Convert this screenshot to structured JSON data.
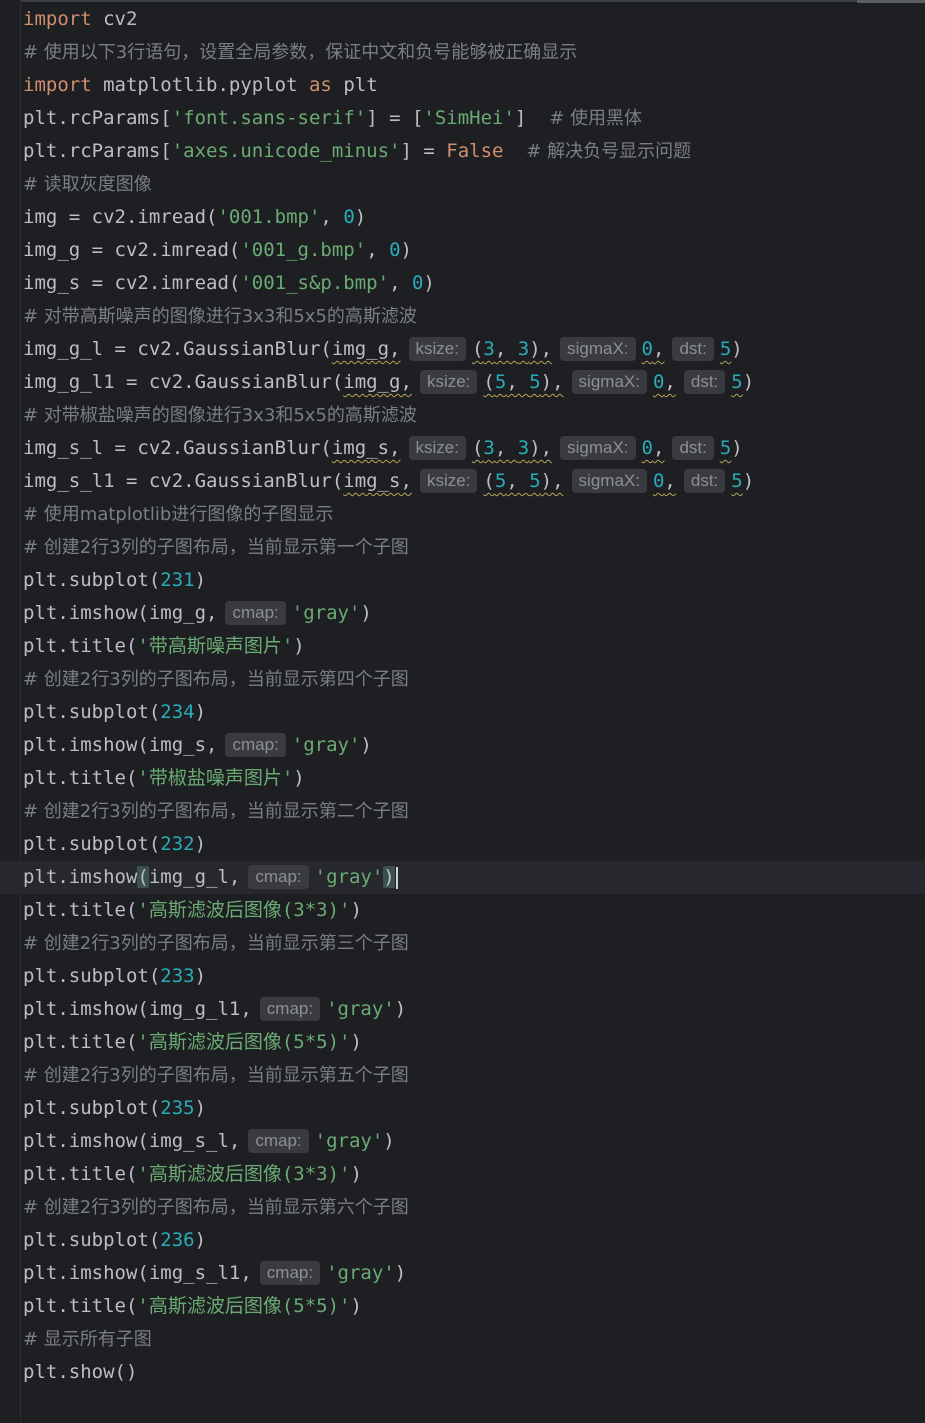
{
  "editor": {
    "lines": [
      {
        "tokens": [
          {
            "t": "kw",
            "v": "import"
          },
          {
            "t": "p",
            "v": " cv2"
          }
        ]
      },
      {
        "tokens": [
          {
            "t": "cmt",
            "v": "# 使用以下3行语句，设置全局参数，保证中文和负号能够被正确显示"
          }
        ]
      },
      {
        "tokens": [
          {
            "t": "kw",
            "v": "import"
          },
          {
            "t": "p",
            "v": " matplotlib.pyplot "
          },
          {
            "t": "kw",
            "v": "as"
          },
          {
            "t": "p",
            "v": " plt"
          }
        ]
      },
      {
        "tokens": [
          {
            "t": "p",
            "v": "plt.rcParams["
          },
          {
            "t": "str",
            "v": "'font.sans-serif'"
          },
          {
            "t": "p",
            "v": "] = ["
          },
          {
            "t": "str",
            "v": "'SimHei'"
          },
          {
            "t": "p",
            "v": "]  "
          },
          {
            "t": "cmt",
            "v": "# 使用黑体"
          }
        ]
      },
      {
        "tokens": [
          {
            "t": "p",
            "v": "plt.rcParams["
          },
          {
            "t": "str",
            "v": "'axes.unicode_minus'"
          },
          {
            "t": "p",
            "v": "] = "
          },
          {
            "t": "kw",
            "v": "False"
          },
          {
            "t": "p",
            "v": "  "
          },
          {
            "t": "cmt",
            "v": "# 解决负号显示问题"
          }
        ]
      },
      {
        "tokens": [
          {
            "t": "cmt",
            "v": "# 读取灰度图像"
          }
        ]
      },
      {
        "tokens": [
          {
            "t": "p",
            "v": "img = cv2.imread("
          },
          {
            "t": "str",
            "v": "'001.bmp'"
          },
          {
            "t": "p",
            "v": ", "
          },
          {
            "t": "num",
            "v": "0"
          },
          {
            "t": "p",
            "v": ")"
          }
        ]
      },
      {
        "tokens": [
          {
            "t": "p",
            "v": "img_g = cv2.imread("
          },
          {
            "t": "str",
            "v": "'001_g.bmp'"
          },
          {
            "t": "p",
            "v": ", "
          },
          {
            "t": "num",
            "v": "0"
          },
          {
            "t": "p",
            "v": ")"
          }
        ]
      },
      {
        "tokens": [
          {
            "t": "p",
            "v": "img_s = cv2.imread("
          },
          {
            "t": "str",
            "v": "'001_s&p.bmp'"
          },
          {
            "t": "p",
            "v": ", "
          },
          {
            "t": "num",
            "v": "0"
          },
          {
            "t": "p",
            "v": ")"
          }
        ]
      },
      {
        "tokens": [
          {
            "t": "cmt",
            "v": "# 对带高斯噪声的图像进行3x3和5x5的高斯滤波"
          }
        ]
      },
      {
        "tokens": [
          {
            "t": "p",
            "v": "img_g_l = cv2.GaussianBlur("
          },
          {
            "t": "pw",
            "v": "img_g,"
          },
          {
            "t": "hint",
            "v": "ksize:"
          },
          {
            "t": "pw",
            "v": "("
          },
          {
            "t": "numw",
            "v": "3"
          },
          {
            "t": "pw",
            "v": ", "
          },
          {
            "t": "numw",
            "v": "3"
          },
          {
            "t": "pw",
            "v": "),"
          },
          {
            "t": "hint",
            "v": "sigmaX:"
          },
          {
            "t": "numw",
            "v": "0"
          },
          {
            "t": "pw",
            "v": ","
          },
          {
            "t": "hint",
            "v": "dst:"
          },
          {
            "t": "numw",
            "v": "5"
          },
          {
            "t": "p",
            "v": ")"
          }
        ]
      },
      {
        "tokens": [
          {
            "t": "p",
            "v": "img_g_l1 = cv2.GaussianBlur("
          },
          {
            "t": "pw",
            "v": "img_g,"
          },
          {
            "t": "hint",
            "v": "ksize:"
          },
          {
            "t": "pw",
            "v": "("
          },
          {
            "t": "numw",
            "v": "5"
          },
          {
            "t": "pw",
            "v": ", "
          },
          {
            "t": "numw",
            "v": "5"
          },
          {
            "t": "pw",
            "v": "),"
          },
          {
            "t": "hint",
            "v": "sigmaX:"
          },
          {
            "t": "numw",
            "v": "0"
          },
          {
            "t": "pw",
            "v": ","
          },
          {
            "t": "hint",
            "v": "dst:"
          },
          {
            "t": "numw",
            "v": "5"
          },
          {
            "t": "p",
            "v": ")"
          }
        ]
      },
      {
        "tokens": [
          {
            "t": "cmt",
            "v": "# 对带椒盐噪声的图像进行3x3和5x5的高斯滤波"
          }
        ]
      },
      {
        "tokens": [
          {
            "t": "p",
            "v": "img_s_l = cv2.GaussianBlur("
          },
          {
            "t": "pw",
            "v": "img_s,"
          },
          {
            "t": "hint",
            "v": "ksize:"
          },
          {
            "t": "pw",
            "v": "("
          },
          {
            "t": "numw",
            "v": "3"
          },
          {
            "t": "pw",
            "v": ", "
          },
          {
            "t": "numw",
            "v": "3"
          },
          {
            "t": "pw",
            "v": "),"
          },
          {
            "t": "hint",
            "v": "sigmaX:"
          },
          {
            "t": "numw",
            "v": "0"
          },
          {
            "t": "pw",
            "v": ","
          },
          {
            "t": "hint",
            "v": "dst:"
          },
          {
            "t": "numw",
            "v": "5"
          },
          {
            "t": "p",
            "v": ")"
          }
        ]
      },
      {
        "tokens": [
          {
            "t": "p",
            "v": "img_s_l1 = cv2.GaussianBlur("
          },
          {
            "t": "pw",
            "v": "img_s,"
          },
          {
            "t": "hint",
            "v": "ksize:"
          },
          {
            "t": "pw",
            "v": "("
          },
          {
            "t": "numw",
            "v": "5"
          },
          {
            "t": "pw",
            "v": ", "
          },
          {
            "t": "numw",
            "v": "5"
          },
          {
            "t": "pw",
            "v": "),"
          },
          {
            "t": "hint",
            "v": "sigmaX:"
          },
          {
            "t": "numw",
            "v": "0"
          },
          {
            "t": "pw",
            "v": ","
          },
          {
            "t": "hint",
            "v": "dst:"
          },
          {
            "t": "numw",
            "v": "5"
          },
          {
            "t": "p",
            "v": ")"
          }
        ]
      },
      {
        "tokens": [
          {
            "t": "cmt",
            "v": "# 使用matplotlib进行图像的子图显示"
          }
        ]
      },
      {
        "tokens": [
          {
            "t": "cmt",
            "v": "# 创建2行3列的子图布局，当前显示第一个子图"
          }
        ]
      },
      {
        "tokens": [
          {
            "t": "p",
            "v": "plt.subplot("
          },
          {
            "t": "num",
            "v": "231"
          },
          {
            "t": "p",
            "v": ")"
          }
        ]
      },
      {
        "tokens": [
          {
            "t": "p",
            "v": "plt.imshow(img_g,"
          },
          {
            "t": "hint",
            "v": "cmap:"
          },
          {
            "t": "str",
            "v": "'gray'"
          },
          {
            "t": "p",
            "v": ")"
          }
        ]
      },
      {
        "tokens": [
          {
            "t": "p",
            "v": "plt.title("
          },
          {
            "t": "str",
            "v": "'带高斯噪声图片'"
          },
          {
            "t": "p",
            "v": ")"
          }
        ]
      },
      {
        "tokens": [
          {
            "t": "cmt",
            "v": "# 创建2行3列的子图布局，当前显示第四个子图"
          }
        ]
      },
      {
        "tokens": [
          {
            "t": "p",
            "v": "plt.subplot("
          },
          {
            "t": "num",
            "v": "234"
          },
          {
            "t": "p",
            "v": ")"
          }
        ]
      },
      {
        "tokens": [
          {
            "t": "p",
            "v": "plt.imshow(img_s,"
          },
          {
            "t": "hint",
            "v": "cmap:"
          },
          {
            "t": "str",
            "v": "'gray'"
          },
          {
            "t": "p",
            "v": ")"
          }
        ]
      },
      {
        "tokens": [
          {
            "t": "p",
            "v": "plt.title("
          },
          {
            "t": "str",
            "v": "'带椒盐噪声图片'"
          },
          {
            "t": "p",
            "v": ")"
          }
        ]
      },
      {
        "tokens": [
          {
            "t": "cmt",
            "v": "# 创建2行3列的子图布局，当前显示第二个子图"
          }
        ]
      },
      {
        "tokens": [
          {
            "t": "p",
            "v": "plt.subplot("
          },
          {
            "t": "num",
            "v": "232"
          },
          {
            "t": "p",
            "v": ")"
          }
        ]
      },
      {
        "current": true,
        "tokens": [
          {
            "t": "p",
            "v": "plt.imshow"
          },
          {
            "t": "brace",
            "v": "("
          },
          {
            "t": "p",
            "v": "img_g_l,"
          },
          {
            "t": "hint",
            "v": "cmap:"
          },
          {
            "t": "str",
            "v": "'gray'"
          },
          {
            "t": "brace",
            "v": ")"
          },
          {
            "t": "cursor",
            "v": ""
          }
        ]
      },
      {
        "tokens": [
          {
            "t": "p",
            "v": "plt.title("
          },
          {
            "t": "str",
            "v": "'高斯滤波后图像(3*3)'"
          },
          {
            "t": "p",
            "v": ")"
          }
        ]
      },
      {
        "tokens": [
          {
            "t": "cmt",
            "v": "# 创建2行3列的子图布局，当前显示第三个子图"
          }
        ]
      },
      {
        "tokens": [
          {
            "t": "p",
            "v": "plt.subplot("
          },
          {
            "t": "num",
            "v": "233"
          },
          {
            "t": "p",
            "v": ")"
          }
        ]
      },
      {
        "tokens": [
          {
            "t": "p",
            "v": "plt.imshow(img_g_l1,"
          },
          {
            "t": "hint",
            "v": "cmap:"
          },
          {
            "t": "str",
            "v": "'gray'"
          },
          {
            "t": "p",
            "v": ")"
          }
        ]
      },
      {
        "tokens": [
          {
            "t": "p",
            "v": "plt.title("
          },
          {
            "t": "str",
            "v": "'高斯滤波后图像(5*5)'"
          },
          {
            "t": "p",
            "v": ")"
          }
        ]
      },
      {
        "tokens": [
          {
            "t": "cmt",
            "v": "# 创建2行3列的子图布局，当前显示第五个子图"
          }
        ]
      },
      {
        "tokens": [
          {
            "t": "p",
            "v": "plt.subplot("
          },
          {
            "t": "num",
            "v": "235"
          },
          {
            "t": "p",
            "v": ")"
          }
        ]
      },
      {
        "tokens": [
          {
            "t": "p",
            "v": "plt.imshow(img_s_l,"
          },
          {
            "t": "hint",
            "v": "cmap:"
          },
          {
            "t": "str",
            "v": "'gray'"
          },
          {
            "t": "p",
            "v": ")"
          }
        ]
      },
      {
        "tokens": [
          {
            "t": "p",
            "v": "plt.title("
          },
          {
            "t": "str",
            "v": "'高斯滤波后图像(3*3)'"
          },
          {
            "t": "p",
            "v": ")"
          }
        ]
      },
      {
        "tokens": [
          {
            "t": "cmt",
            "v": "# 创建2行3列的子图布局，当前显示第六个子图"
          }
        ]
      },
      {
        "tokens": [
          {
            "t": "p",
            "v": "plt.subplot("
          },
          {
            "t": "num",
            "v": "236"
          },
          {
            "t": "p",
            "v": ")"
          }
        ]
      },
      {
        "tokens": [
          {
            "t": "p",
            "v": "plt.imshow(img_s_l1,"
          },
          {
            "t": "hint",
            "v": "cmap:"
          },
          {
            "t": "str",
            "v": "'gray'"
          },
          {
            "t": "p",
            "v": ")"
          }
        ]
      },
      {
        "tokens": [
          {
            "t": "p",
            "v": "plt.title("
          },
          {
            "t": "str",
            "v": "'高斯滤波后图像(5*5)'"
          },
          {
            "t": "p",
            "v": ")"
          }
        ]
      },
      {
        "tokens": [
          {
            "t": "cmt",
            "v": "# 显示所有子图"
          }
        ]
      },
      {
        "tokens": [
          {
            "t": "p",
            "v": "plt.show()"
          }
        ]
      }
    ]
  },
  "colors": {
    "background": "#1e1f22",
    "keyword": "#cf8e6d",
    "string": "#6aab73",
    "number": "#2aacb8",
    "comment": "#7a7e85",
    "text": "#bcbec4",
    "hint_bg": "#393b40"
  }
}
